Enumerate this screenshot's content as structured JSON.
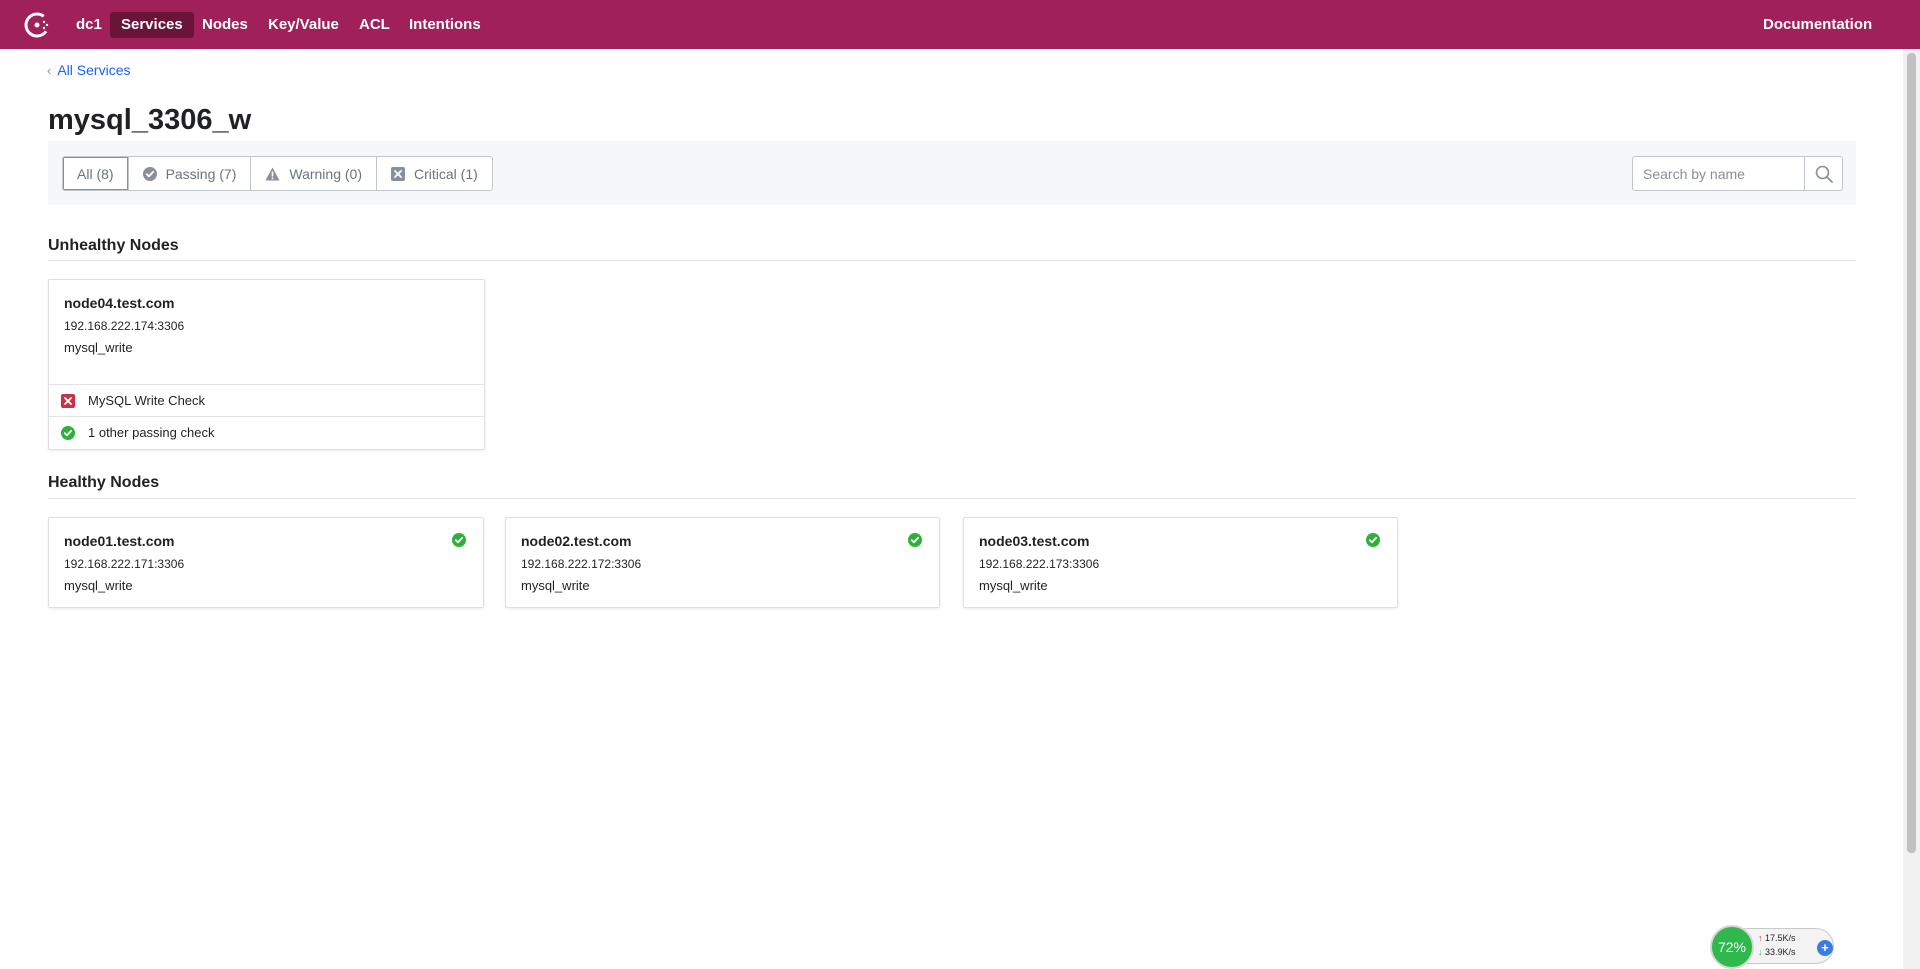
{
  "nav": {
    "datacenter": "dc1",
    "items": [
      {
        "label": "Services",
        "active": true
      },
      {
        "label": "Nodes"
      },
      {
        "label": "Key/Value"
      },
      {
        "label": "ACL"
      },
      {
        "label": "Intentions"
      }
    ],
    "documentation": "Documentation",
    "brand_color": "#a0215a",
    "active_color": "#6b1439"
  },
  "breadcrumb": {
    "label": "All Services"
  },
  "page": {
    "title": "mysql_3306_w"
  },
  "filters": {
    "all": "All (8)",
    "passing": "Passing (7)",
    "warning": "Warning (0)",
    "critical": "Critical (1)"
  },
  "search": {
    "placeholder": "Search by name",
    "value": ""
  },
  "unhealthy": {
    "title": "Unhealthy Nodes",
    "nodes": [
      {
        "name": "node04.test.com",
        "address": "192.168.222.174:3306",
        "service": "mysql_write",
        "failing_check": "MySQL Write Check",
        "passing_summary": "1 other passing check"
      }
    ]
  },
  "healthy": {
    "title": "Healthy Nodes",
    "nodes": [
      {
        "name": "node01.test.com",
        "address": "192.168.222.171:3306",
        "service": "mysql_write"
      },
      {
        "name": "node02.test.com",
        "address": "192.168.222.172:3306",
        "service": "mysql_write"
      },
      {
        "name": "node03.test.com",
        "address": "192.168.222.173:3306",
        "service": "mysql_write"
      }
    ]
  },
  "colors": {
    "passing": "#2eb039",
    "critical": "#c73445",
    "link": "#1563ff"
  },
  "network_widget": {
    "percent": "72%",
    "upload": "17.5K/s",
    "download": "33.9K/s"
  }
}
